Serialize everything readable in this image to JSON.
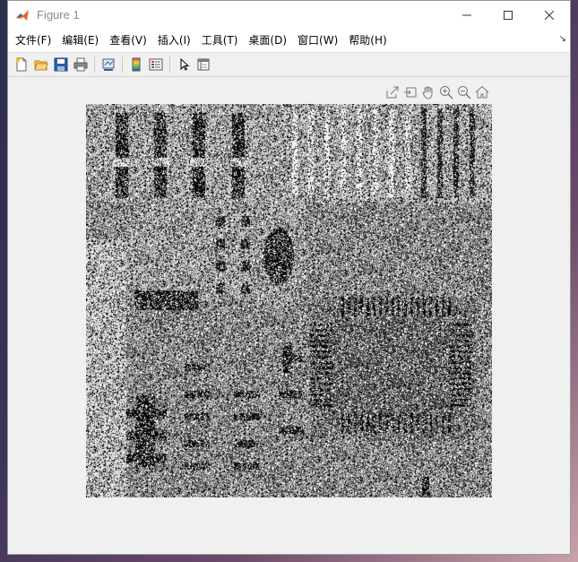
{
  "window": {
    "title": "Figure 1",
    "controls": {
      "minimize": "—",
      "maximize": "☐",
      "close": "✕"
    }
  },
  "menu": {
    "items": [
      {
        "label": "文件(F)",
        "name": "menu-file"
      },
      {
        "label": "编辑(E)",
        "name": "menu-edit"
      },
      {
        "label": "查看(V)",
        "name": "menu-view"
      },
      {
        "label": "插入(I)",
        "name": "menu-insert"
      },
      {
        "label": "工具(T)",
        "name": "menu-tools"
      },
      {
        "label": "桌面(D)",
        "name": "menu-desktop"
      },
      {
        "label": "窗口(W)",
        "name": "menu-window"
      },
      {
        "label": "帮助(H)",
        "name": "menu-help"
      }
    ],
    "corner_glyph": "↘"
  },
  "toolbar": {
    "icons": [
      "new-figure-icon",
      "open-file-icon",
      "save-icon",
      "print-icon",
      "link-plot-icon",
      "colorbar-icon",
      "legend-icon",
      "edit-plot-icon",
      "property-inspector-icon"
    ]
  },
  "axes_toolbar": {
    "icons": [
      "export-icon",
      "brush-icon",
      "pan-hand-icon",
      "zoom-in-icon",
      "zoom-out-icon",
      "home-icon"
    ]
  },
  "image": {
    "description_kind": "grayscale circuit board with salt-and-pepper noise"
  },
  "colors": {
    "window_bg": "#f0f0f0",
    "titlebar_bg": "#ffffff",
    "accent_matlab": "#e5692b"
  }
}
